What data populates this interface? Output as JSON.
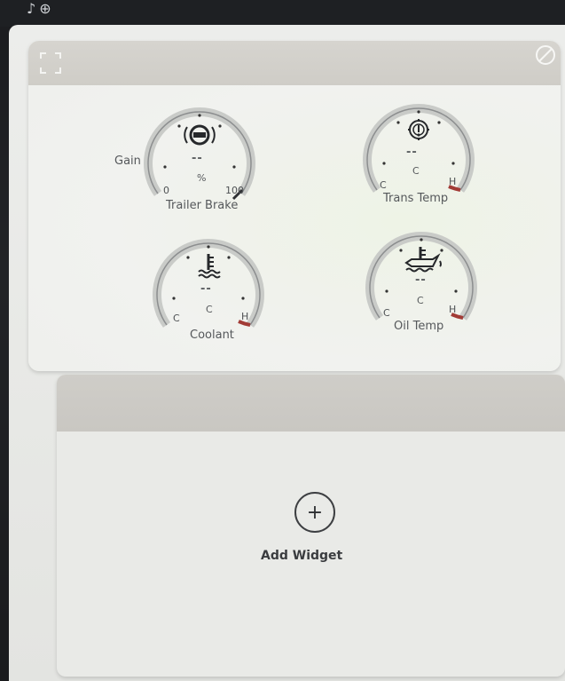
{
  "status_bar": {
    "icons": [
      "music-note-icon",
      "settings-icon"
    ],
    "glyphs": "♪⊕"
  },
  "gauges_widget": {
    "expand_icon": "expand-icon",
    "remove_icon": "remove-icon",
    "gauges": [
      {
        "id": "trailer_brake",
        "title": "Trailer Brake",
        "icon": "trailer-brake-icon",
        "value": "--",
        "unit": "%",
        "min_label": "0",
        "max_label": "100",
        "side_label": "Gain"
      },
      {
        "id": "trans_temp",
        "title": "Trans Temp",
        "icon": "transmission-temp-icon",
        "value": "--",
        "unit": "C",
        "min_label": "C",
        "max_label": "H"
      },
      {
        "id": "coolant",
        "title": "Coolant",
        "icon": "coolant-temp-icon",
        "value": "--",
        "unit": "C",
        "min_label": "C",
        "max_label": "H"
      },
      {
        "id": "oil_temp",
        "title": "Oil Temp",
        "icon": "oil-temp-icon",
        "value": "--",
        "unit": "C",
        "min_label": "C",
        "max_label": "H"
      }
    ],
    "colors": {
      "hot_zone": "#a23b36",
      "arc": "#c9cbc8",
      "arc_edge": "#8c8e8f"
    }
  },
  "empty_widget": {
    "add_label": "Add Widget",
    "add_icon": "plus-circle-icon",
    "add_symbol": "+"
  }
}
